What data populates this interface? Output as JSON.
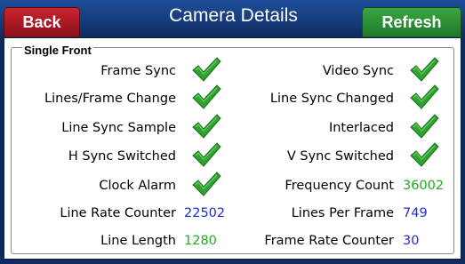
{
  "header": {
    "title": "Camera Details",
    "back_label": "Back",
    "refresh_label": "Refresh"
  },
  "group": {
    "title": "Single Front"
  },
  "left": [
    {
      "label": "Frame Sync",
      "status": "ok"
    },
    {
      "label": "Lines/Frame Change",
      "status": "ok"
    },
    {
      "label": "Line Sync Sample",
      "status": "ok"
    },
    {
      "label": "H Sync Switched",
      "status": "ok"
    },
    {
      "label": "Clock Alarm",
      "status": "ok"
    },
    {
      "label": "Line Rate Counter",
      "value": "22502",
      "color": "#1f2fd1"
    },
    {
      "label": "Line Length",
      "value": "1280",
      "color": "#22aa22"
    }
  ],
  "right": [
    {
      "label": "Video Sync",
      "status": "ok"
    },
    {
      "label": "Line Sync Changed",
      "status": "ok"
    },
    {
      "label": "Interlaced",
      "status": "ok"
    },
    {
      "label": "V Sync Switched",
      "status": "ok"
    },
    {
      "label": "Frequency Count",
      "value": "36002",
      "color": "#22aa22"
    },
    {
      "label": "Lines Per Frame",
      "value": "749",
      "color": "#1f2fd1"
    },
    {
      "label": "Frame Rate Counter",
      "value": "30",
      "color": "#1f2fd1"
    }
  ],
  "colors": {
    "header_bg": "#163b7c",
    "back_button": "#b01a24",
    "refresh_button": "#2a8f34",
    "check": "#2fa32f"
  }
}
